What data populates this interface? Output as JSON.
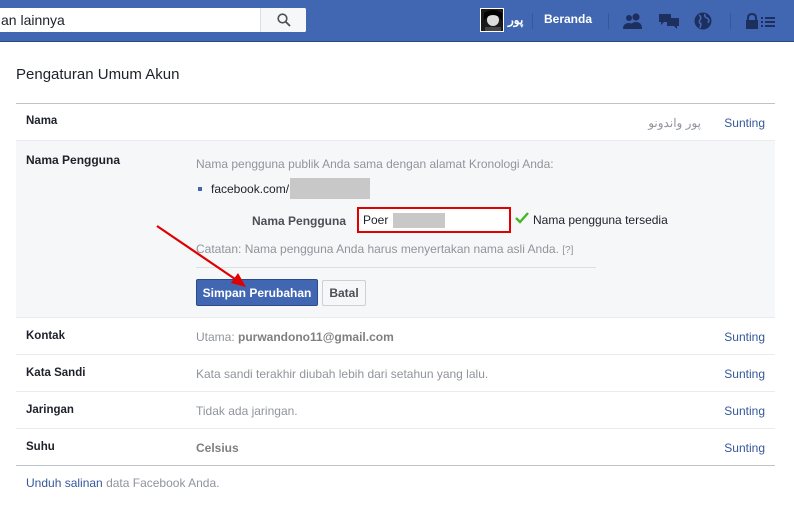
{
  "topbar": {
    "search_placeholder": "an lainnya",
    "user_name": "پور",
    "home_label": "Beranda"
  },
  "page": {
    "title": "Pengaturan Umum Akun"
  },
  "settings": {
    "name": {
      "label": "Nama",
      "value": "پور واندونو",
      "edit": "Sunting"
    },
    "username": {
      "label": "Nama Pengguna",
      "description": "Nama pengguna publik Anda sama dengan alamat Kronologi Anda:",
      "url_prefix": "facebook.com/",
      "field_label": "Nama Pengguna",
      "field_value": "Poer",
      "available_text": "Nama pengguna tersedia",
      "note": "Catatan: Nama pengguna Anda harus menyertakan nama asli Anda.",
      "note_help": "[?]",
      "save_button": "Simpan Perubahan",
      "cancel_button": "Batal"
    },
    "contact": {
      "label": "Kontak",
      "prefix": "Utama: ",
      "value": "purwandono11@gmail.com",
      "edit": "Sunting"
    },
    "password": {
      "label": "Kata Sandi",
      "value": "Kata sandi terakhir diubah lebih dari setahun yang lalu.",
      "edit": "Sunting"
    },
    "network": {
      "label": "Jaringan",
      "value": "Tidak ada jaringan.",
      "edit": "Sunting"
    },
    "temperature": {
      "label": "Suhu",
      "value": "Celsius",
      "edit": "Sunting"
    }
  },
  "footer": {
    "link": "Unduh salinan",
    "text": " data Facebook Anda."
  },
  "colors": {
    "brand": "#4267b2",
    "link": "#365899",
    "highlight_border": "#e00000",
    "annotation_arrow": "#e00000",
    "check": "#42b72a"
  }
}
